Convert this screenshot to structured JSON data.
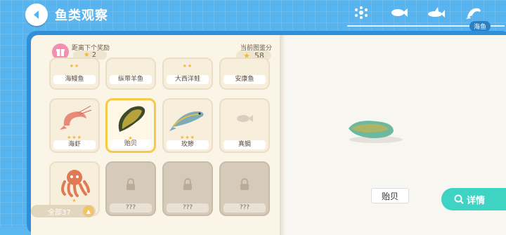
{
  "header": {
    "title": "鱼类观察",
    "active_tab_label": "海鱼",
    "tabs": [
      {
        "icon": "bubbles-icon"
      },
      {
        "icon": "fish-icon"
      },
      {
        "icon": "shark-icon"
      },
      {
        "icon": "dolphin-icon"
      }
    ]
  },
  "stats": {
    "reward_label": "距离下个奖励",
    "reward_count": "2",
    "score_label": "当前图鉴分",
    "score_value": "58"
  },
  "top_row_names": [
    "海鳗鱼",
    "纵带羊鱼",
    "大西洋鲑",
    "安康鱼"
  ],
  "cards": [
    {
      "name": "海虾",
      "stars": "★★★"
    },
    {
      "name": "贻贝",
      "stars": "★"
    },
    {
      "name": "玫鲹",
      "stars": "★★★"
    },
    {
      "name": "真鲷",
      "stars": ""
    },
    {
      "name": "",
      "stars": "★"
    },
    {
      "name": "???",
      "stars": ""
    },
    {
      "name": "???",
      "stars": ""
    },
    {
      "name": "???",
      "stars": ""
    }
  ],
  "top_row_stars": [
    "★★",
    "",
    "★★",
    ""
  ],
  "footer": {
    "total_label": "全部37"
  },
  "detail": {
    "selected_name": "贻贝",
    "detail_button": "详情"
  },
  "colors": {
    "accent": "#3fd3c4",
    "selected_border": "#f7c948",
    "background": "#58b4ee"
  }
}
